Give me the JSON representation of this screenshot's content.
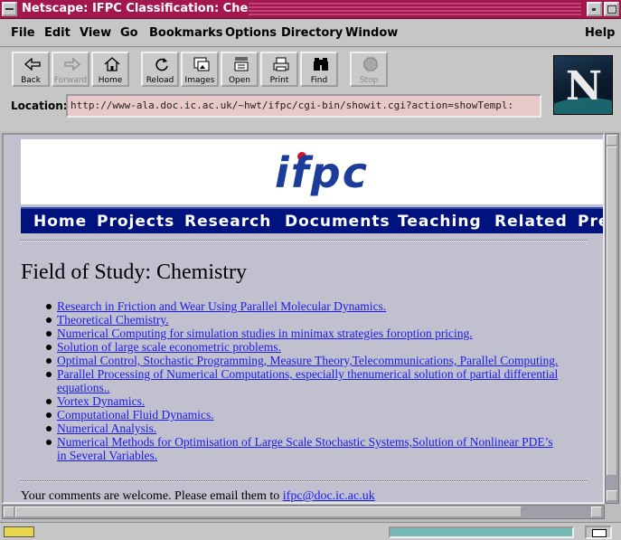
{
  "window": {
    "title": "Netscape: IFPC Classification: Chemistry"
  },
  "menu": [
    "File",
    "Edit",
    "View",
    "Go",
    "Bookmarks",
    "Options",
    "Directory",
    "Window",
    "Help"
  ],
  "toolbar": {
    "buttons": [
      {
        "label": "Back",
        "icon": "back-arrow-icon"
      },
      {
        "label": "Forward",
        "icon": "forward-arrow-icon",
        "disabled": true
      },
      {
        "label": "Home",
        "icon": "home-icon"
      },
      {
        "label": "Reload",
        "icon": "reload-icon"
      },
      {
        "label": "Images",
        "icon": "images-icon"
      },
      {
        "label": "Open",
        "icon": "open-icon"
      },
      {
        "label": "Print",
        "icon": "print-icon"
      },
      {
        "label": "Find",
        "icon": "find-binoculars-icon"
      },
      {
        "label": "Stop",
        "icon": "stop-icon",
        "disabled": true
      }
    ]
  },
  "location": {
    "label": "Location:",
    "url": "http://www-ala.doc.ic.ac.uk/~hwt/ifpc/cgi-bin/showit.cgi?action=showTempl:"
  },
  "brand": {
    "logo_letter": "N"
  },
  "page": {
    "logo_text": "ifpc",
    "nav": [
      "Home",
      "Projects",
      "Research",
      "Documents",
      "Teaching",
      "Related",
      "Pre"
    ],
    "title": "Field of Study: Chemistry",
    "items": [
      [
        "Research in Friction and Wear Using Parallel Molecular Dynamics."
      ],
      [
        "Theoretical Chemistry."
      ],
      [
        "Numerical Computing for simulation studies in minimax strategies foroption pricing."
      ],
      [
        "Solution of large scale econometric problems."
      ],
      [
        "Optimal Control, Stochastic Programming, Measure Theory,Telecommunications, Parallel Computing."
      ],
      [
        "Parallel Processing of Numerical Computations, especially thenumerical solution of partial differential",
        "equations.."
      ],
      [
        "Vortex Dynamics."
      ],
      [
        "Computational Fluid Dynamics."
      ],
      [
        "Numerical Analysis."
      ],
      [
        "Numerical Methods for Optimisation of Large Scale Stochastic Systems,Solution of Nonlinear PDE’s",
        "in Several Variables."
      ]
    ],
    "footer_text": "Your comments are welcome. Please email them to ",
    "footer_email": "ifpc@doc.ic.ac.uk"
  },
  "colors": {
    "titlebar": "#a3174e",
    "nav_bg": "#00127e",
    "logo": "#1b3c9a",
    "link": "#1a1aee",
    "content_bg": "#c0c0cf"
  }
}
